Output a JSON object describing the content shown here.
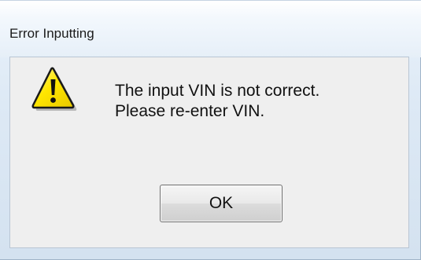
{
  "dialog": {
    "title": "Error Inputting",
    "icon": "warning-icon",
    "message_lines": [
      "The input VIN is not correct.",
      "Please re-enter VIN."
    ],
    "ok_label": "OK"
  },
  "colors": {
    "warning_yellow": "#ffe800",
    "warning_outline": "#1a1a1a",
    "client_background": "#efefef"
  }
}
